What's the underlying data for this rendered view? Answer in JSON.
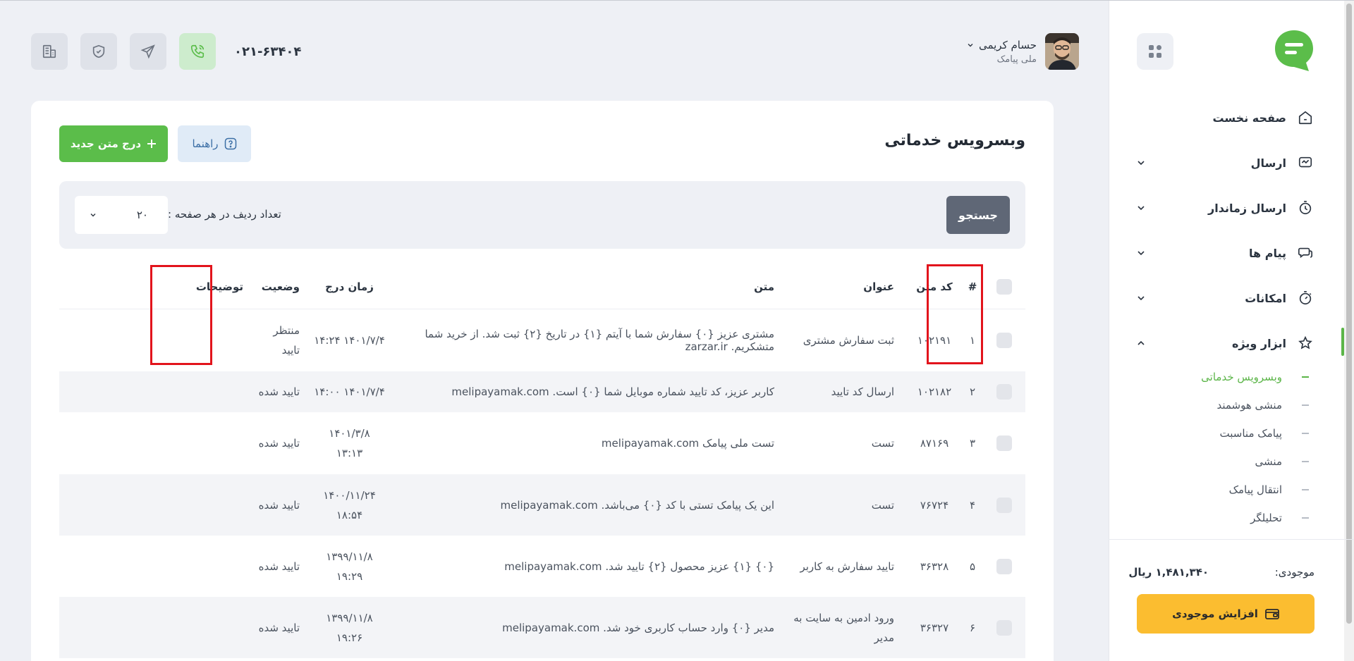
{
  "sidebar": {
    "nav": [
      {
        "label": "صفحه نخست",
        "icon": "home-icon"
      },
      {
        "label": "ارسال",
        "icon": "send-icon"
      },
      {
        "label": "ارسال زماندار",
        "icon": "timer-icon"
      },
      {
        "label": "پیام ها",
        "icon": "chat-icon"
      },
      {
        "label": "امکانات",
        "icon": "stopwatch-icon"
      },
      {
        "label": "ابزار ویژه",
        "icon": "star-icon"
      }
    ],
    "subnav": [
      "وبسرویس خدماتی",
      "منشی هوشمند",
      "پیامک مناسبت",
      "منشی",
      "انتقال پیامک",
      "تحلیلگر"
    ],
    "balance_label": "موجودی:",
    "balance_value": "۱,۴۸۱,۳۴۰ ریال",
    "topup_label": "افزایش موجودی"
  },
  "header": {
    "user_name": "حسام کریمی",
    "user_sub": "ملی پیامک",
    "phone": "۰۲۱-۶۳۴۰۴"
  },
  "page": {
    "title": "وبسرویس خدماتی",
    "new_button": "درج متن جدید",
    "help_button": "راهنما",
    "search_button": "جستجو",
    "rows_label": "تعداد ردیف در هر صفحه :",
    "rows_value": "۲۰"
  },
  "table": {
    "headers": {
      "num": "#",
      "code": "کد متن",
      "title": "عنوان",
      "text": "متن",
      "time": "زمان درج",
      "status": "وضعیت",
      "desc": "توضیحات"
    },
    "rows": [
      {
        "num": "۱",
        "code": "۱۰۲۱۹۱",
        "title": "ثبت سفارش مشتری",
        "text": "مشتری عزیز {۰} سفارش شما با آیتم {۱} در تاریخ {۲} ثبت شد. از خرید شما متشکریم. zarzar.ir",
        "date": "۱۴۰۱/۷/۴",
        "clock": "۱۴:۲۴",
        "status": "منتظر تایید"
      },
      {
        "num": "۲",
        "code": "۱۰۲۱۸۲",
        "title": "ارسال کد تایید",
        "text": "کاربر عزیز، کد تایید شماره موبایل شما {۰} است. melipayamak.com",
        "date": "۱۴۰۱/۷/۴",
        "clock": "۱۴:۰۰",
        "status": "تایید شده"
      },
      {
        "num": "۳",
        "code": "۸۷۱۶۹",
        "title": "تست",
        "text": "تست ملی پیامک melipayamak.com",
        "date": "۱۴۰۱/۳/۸",
        "clock": "۱۳:۱۳",
        "status": "تایید شده"
      },
      {
        "num": "۴",
        "code": "۷۶۷۲۴",
        "title": "تست",
        "text": "این یک پیامک تستی با کد {۰} می‌باشد. melipayamak.com",
        "date": "۱۴۰۰/۱۱/۲۴",
        "clock": "۱۸:۵۴",
        "status": "تایید شده"
      },
      {
        "num": "۵",
        "code": "۳۶۳۲۸",
        "title": "تایید سفارش به کاربر",
        "text": "{۰} {۱} عزیز محصول {۲} تایید شد. melipayamak.com",
        "date": "۱۳۹۹/۱۱/۸",
        "clock": "۱۹:۲۹",
        "status": "تایید شده"
      },
      {
        "num": "۶",
        "code": "۳۶۳۲۷",
        "title": "ورود ادمین به سایت به مدیر",
        "text": "مدیر {۰} وارد حساب کاربری خود شد. melipayamak.com",
        "date": "۱۳۹۹/۱۱/۸",
        "clock": "۱۹:۲۶",
        "status": "تایید شده"
      }
    ]
  }
}
